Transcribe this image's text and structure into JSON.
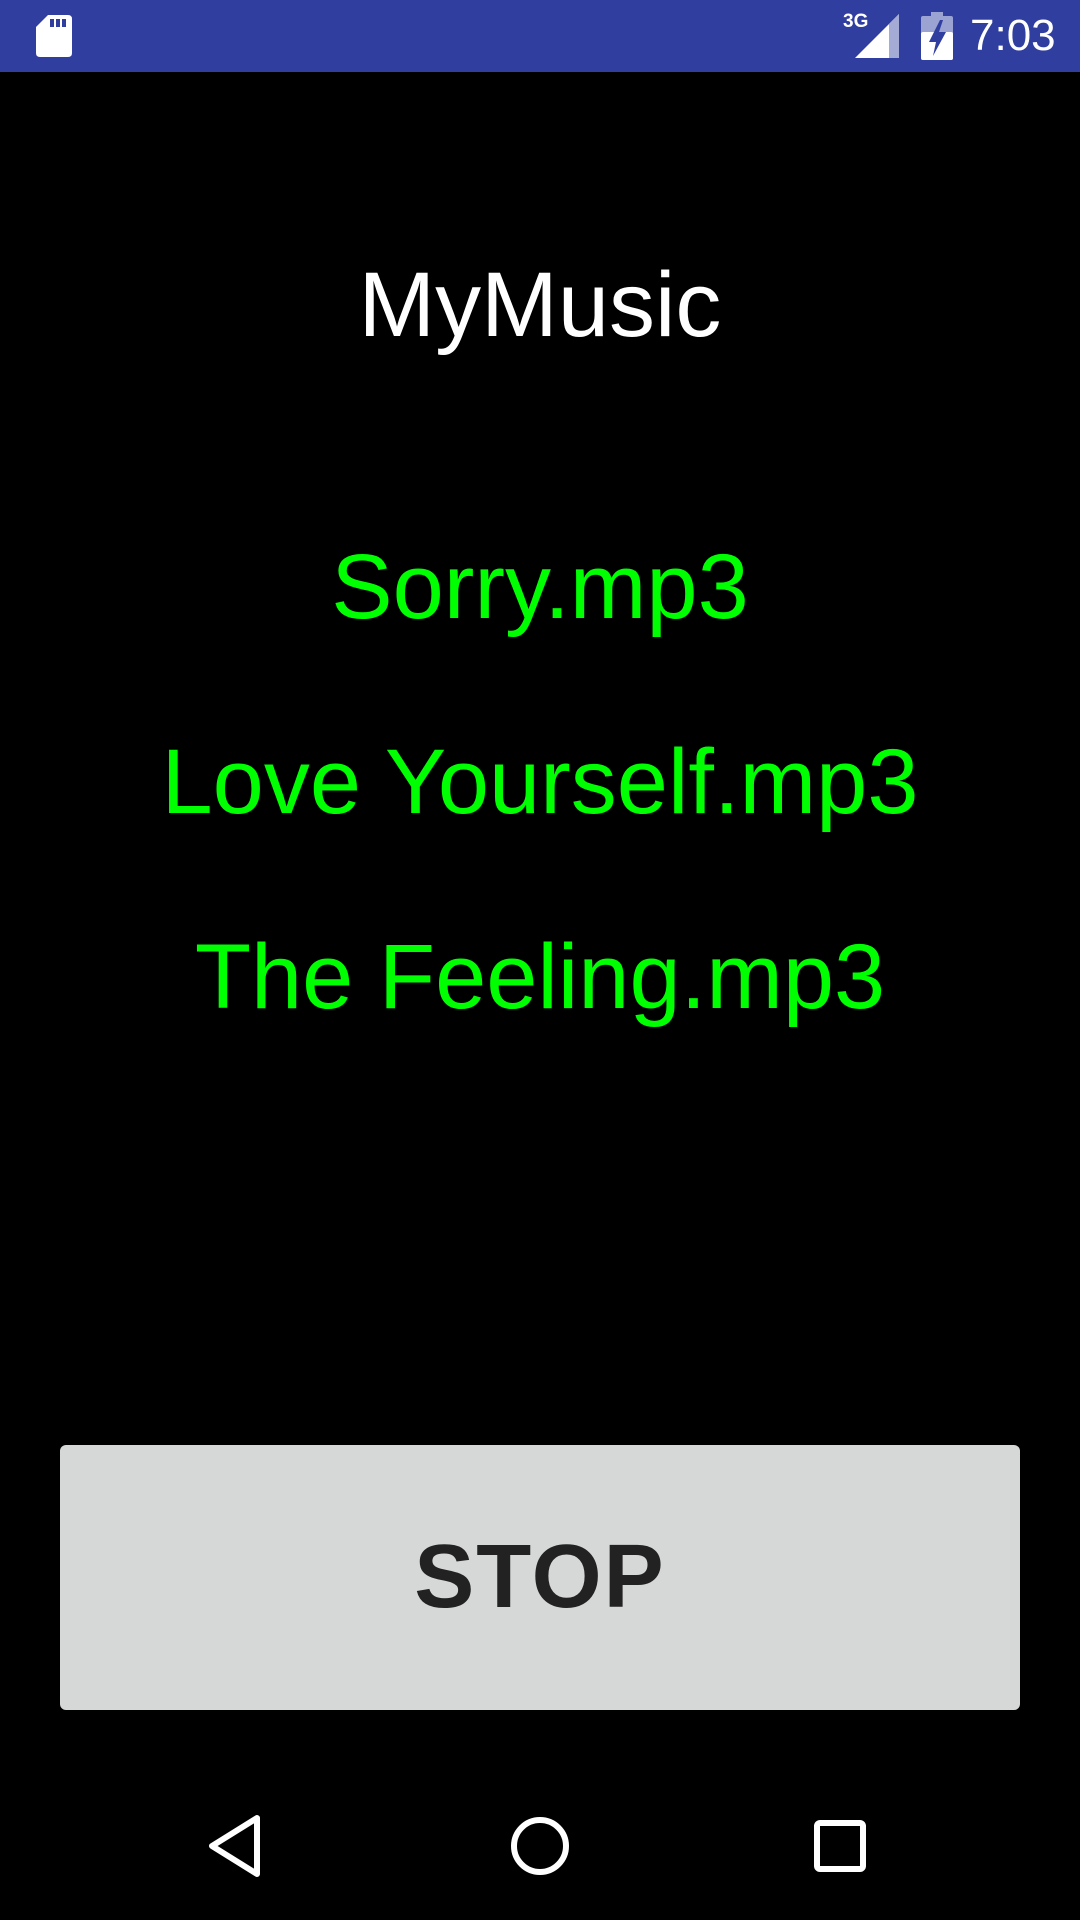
{
  "status_bar": {
    "network_type": "3G",
    "time": "7:03",
    "background_color": "#303F9F",
    "icons": [
      "sd-card-icon",
      "signal-icon",
      "battery-charging-icon"
    ]
  },
  "app": {
    "title": "MyMusic",
    "songs": [
      {
        "label": "Sorry.mp3"
      },
      {
        "label": "Love Yourself.mp3"
      },
      {
        "label": "The Feeling.mp3"
      }
    ],
    "song_color": "#00FF00",
    "stop_label": "STOP"
  },
  "nav_bar": {
    "icons": [
      "back-icon",
      "home-icon",
      "recents-icon"
    ]
  }
}
